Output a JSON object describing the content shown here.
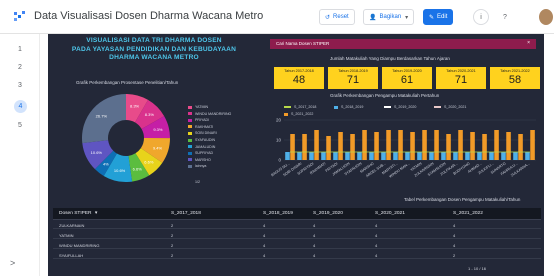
{
  "app": {
    "title": "Data Visualisasi Dosen Dharma Wacana Metro",
    "reset_label": "Reset",
    "share_label": "Bagikan",
    "edit_label": "Edit",
    "info_label": "i",
    "help_label": "?",
    "share_menu_label": "▾"
  },
  "pages": [
    "1",
    "2",
    "3",
    "4",
    "5"
  ],
  "active_page": "4",
  "expand_label": ">",
  "report": {
    "title_line1": "VISUALISASI DATA TRI DHARMA DOSEN",
    "title_line2": "PADA YAYASAN PENDIDIKAN DAN KEBUDAYAAN",
    "title_line3": "DHARMA WACANA METRO",
    "search_label": "Cari Nama Dosen STIPER",
    "search_close": "×",
    "courses_title": "Jumlah Matakuliah Yang Diampu Berdasarkan Tahun Ajaran",
    "pie_title": "Grafik Perkembangan Prosentase Penelitian/Tahun",
    "bar_title": "Grafik Perkembangan Pengampu Matakuliah Pertahun",
    "table_title": "Tabel Perkembangan Dosen Pengampu Matakuliah/Tahun"
  },
  "year_boxes": [
    {
      "label": "Tahun 2017-2018",
      "value": "48"
    },
    {
      "label": "Tahun 2018-2019",
      "value": "71"
    },
    {
      "label": "Tahun 2019-2020",
      "value": "61"
    },
    {
      "label": "Tahun 2020-2021",
      "value": "71"
    },
    {
      "label": "Tahun 2021-2022",
      "value": "58"
    }
  ],
  "pie": {
    "slices": [
      {
        "label": "YATMIN",
        "value": 8.3,
        "color": "#e84b8a"
      },
      {
        "label": "WINDU MANDRIRING",
        "value": 8.3,
        "color": "#d9328c"
      },
      {
        "label": "PRIYADI",
        "value": 8.3,
        "color": "#c51fa6"
      },
      {
        "label": "RAKHMATI",
        "value": 9.4,
        "color": "#f0a72c"
      },
      {
        "label": "SOBI DINARI",
        "value": 6.6,
        "color": "#e8d31b"
      },
      {
        "label": "SYAFAUDIN",
        "value": 6.6,
        "color": "#5bbd3f"
      },
      {
        "label": "JAMALUDIN",
        "value": 10.6,
        "color": "#22a0d6"
      },
      {
        "label": "SUPRIYAD",
        "value": 4,
        "color": "#0e6fb5"
      },
      {
        "label": "MARSHO",
        "value": 10.6,
        "color": "#5f55c2"
      },
      {
        "label": "lainnya",
        "value": 26.7,
        "color": "#5c6f8e"
      }
    ],
    "slice_labels": [
      "8.3%",
      "8.3%",
      "9.3%",
      "9.4%",
      "6.6%",
      "6.6%",
      "10.6%",
      "4%",
      "10.6%",
      "26.7%"
    ],
    "legend_page": "1/2"
  },
  "chart_data": {
    "type": "bar",
    "title": "Grafik Perkembangan Pengampu Matakuliah Pertahun",
    "categories": [
      "BAGUS NU...",
      "SOBI DINARI",
      "SUPRIYADI",
      "RAKHMATI",
      "PRIYADI",
      "JAMALUDIN",
      "SYAFAUDIN",
      "MARSHO",
      "ARDEL SUB...",
      "MARYATI...",
      "WINDU MAN...",
      "YATMIN",
      "ZULKARNAIN",
      "SYAMSUDIN",
      "ZULFIKAR...",
      "BUDIYONO",
      "AHMAD...",
      "ZULKIFLI...",
      "SUNARTO",
      "FAHRULU...",
      "ZULKARNA..."
    ],
    "series": [
      {
        "name": "S_2017_2018",
        "color": "#b7d94a",
        "type": "line"
      },
      {
        "name": "S_2018_2019",
        "color": "#4fb0e8",
        "type": "bar"
      },
      {
        "name": "S_2019_2020",
        "color": "#ffffff",
        "type": "line"
      },
      {
        "name": "S_2020_2021",
        "color": "#e8c9c9",
        "type": "line"
      },
      {
        "name": "S_2021_2022",
        "color": "#f29b28",
        "type": "bar"
      }
    ],
    "values_2018_2019": [
      4,
      4,
      4,
      4,
      4,
      4,
      4,
      4,
      4,
      4,
      4,
      4,
      4,
      4,
      4,
      4,
      4,
      4,
      4,
      4,
      4
    ],
    "values_2021_2022": [
      13,
      13,
      15,
      12,
      14,
      13,
      15,
      14,
      15,
      15,
      14,
      15,
      15,
      13,
      15,
      14,
      13,
      15,
      14,
      13,
      15
    ],
    "values_line": [
      4,
      4,
      4,
      4,
      4,
      4,
      4,
      4,
      4,
      4,
      4,
      4,
      4,
      4,
      4,
      4,
      4,
      4,
      4,
      4,
      4
    ],
    "yticks": [
      "20",
      "10",
      "0"
    ],
    "ylim": [
      0,
      20
    ]
  },
  "table": {
    "columns": [
      "Dosen STIPER",
      "S_2017_2018",
      "S_2018_2019",
      "S_2019_2020",
      "S_2020_2021",
      "S_2021_2022"
    ],
    "sort_icon": "▾",
    "rows": [
      [
        "ZULKARNAIN",
        "2",
        "4",
        "4",
        "4",
        "4"
      ],
      [
        "YATMIN",
        "2",
        "4",
        "4",
        "4",
        "4"
      ],
      [
        "WINDU MANDRIRING",
        "2",
        "4",
        "4",
        "4",
        "4"
      ],
      [
        "SYAIFULLAH",
        "2",
        "4",
        "4",
        "4",
        "2"
      ]
    ],
    "pager": "1 - 10 / 16"
  }
}
